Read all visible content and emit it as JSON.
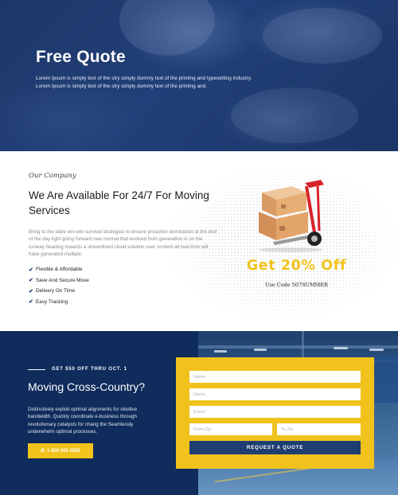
{
  "hero": {
    "title": "Free Quote",
    "text_line1": "Lorem Ipsum is simply text of the stry simply dummy text of the printing and typesetting industry.",
    "text_line2": "Lorem Ipsum is simply text of the stry simply dummy text of the printing and."
  },
  "about": {
    "eyebrow": "Our Company",
    "heading": "We Are Available For 24/7 For Moving Services",
    "description": "Bring to the table win-win survival strategies to ensure proactive domination at the end of the day light going forward new normal that evolved from generation is on the runway heading towards a streamlined cloud solution user content all real-time will have generated multiple.",
    "features": [
      "Flexible & Affordable",
      "Save And Secure Move",
      "Delivery On Time",
      "Easy Tracking"
    ],
    "promo_title": "Get 20% Off",
    "promo_code": "Use Code 507SUMMER"
  },
  "cta": {
    "offer": "GET $50 OFF THRU OCT. 1",
    "heading": "Moving Cross-Country?",
    "text": "Distinctively exploit optimal alignments for intuitive bandwidth. Quickly coordinate e-business through revolutionary catalysts for chang the Seamlessly underwhelm optimal processes.",
    "phone": "1 800 555 5555"
  },
  "form": {
    "name1_placeholder": "Name",
    "name2_placeholder": "Name",
    "email_placeholder": "Email",
    "from_zip_placeholder": "From Zip",
    "to_zip_placeholder": "To Zip",
    "submit_label": "REQUEST A QUOTE"
  },
  "colors": {
    "navy": "#0f2c5c",
    "accent_yellow": "#f2c31b",
    "button_blue": "#1e3e72"
  }
}
